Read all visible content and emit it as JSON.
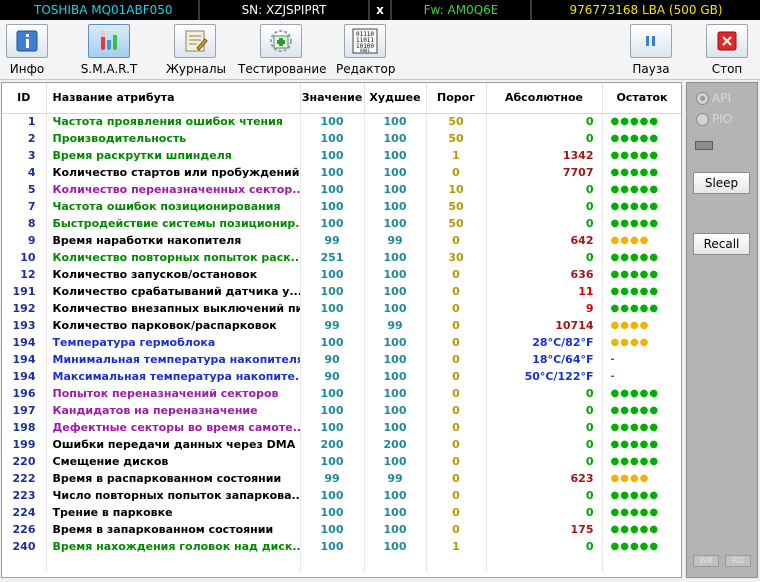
{
  "topbar": {
    "model": "TOSHIBA MQ01ABF050",
    "sn": "SN: XZJSPIPRT",
    "close": "x",
    "fw": "Fw: AM0Q6E",
    "lba": "976773168 LBA (500 GB)"
  },
  "toolbar": {
    "info": "Инфо",
    "smart": "S.M.A.R.T",
    "logs": "Журналы",
    "test": "Тестирование",
    "editor": "Редактор",
    "pause": "Пауза",
    "stop": "Стоп"
  },
  "columns": {
    "id": "ID",
    "name": "Название атрибута",
    "value": "Значение",
    "worst": "Худшее",
    "threshold": "Порог",
    "raw": "Абсолютное",
    "remaining": "Остаток"
  },
  "rows": [
    {
      "id": "1",
      "name": "Частота проявления ошибок чтения",
      "value": "100",
      "worst": "100",
      "threshold": "50",
      "raw": "0",
      "remaining": "●●●●●"
    },
    {
      "id": "2",
      "name": "Производительность",
      "value": "100",
      "worst": "100",
      "threshold": "50",
      "raw": "0",
      "remaining": "●●●●●"
    },
    {
      "id": "3",
      "name": "Время раскрутки шпинделя",
      "value": "100",
      "worst": "100",
      "threshold": "1",
      "raw": "1342",
      "remaining": "●●●●●"
    },
    {
      "id": "4",
      "name": "Количество стартов или пробуждений",
      "value": "100",
      "worst": "100",
      "threshold": "0",
      "raw": "7707",
      "remaining": "●●●●●"
    },
    {
      "id": "5",
      "name": "Количество переназначенных сектор...",
      "value": "100",
      "worst": "100",
      "threshold": "10",
      "raw": "0",
      "remaining": "●●●●●"
    },
    {
      "id": "7",
      "name": "Частота ошибок позиционирования",
      "value": "100",
      "worst": "100",
      "threshold": "50",
      "raw": "0",
      "remaining": "●●●●●"
    },
    {
      "id": "8",
      "name": "Быстродействие системы позиционир...",
      "value": "100",
      "worst": "100",
      "threshold": "50",
      "raw": "0",
      "remaining": "●●●●●"
    },
    {
      "id": "9",
      "name": "Время наработки накопителя",
      "value": "99",
      "worst": "99",
      "threshold": "0",
      "raw": "642",
      "remaining": "●●●●"
    },
    {
      "id": "10",
      "name": "Количество повторных попыток раск...",
      "value": "251",
      "worst": "100",
      "threshold": "30",
      "raw": "0",
      "remaining": "●●●●●"
    },
    {
      "id": "12",
      "name": "Количество запусков/остановок",
      "value": "100",
      "worst": "100",
      "threshold": "0",
      "raw": "636",
      "remaining": "●●●●●"
    },
    {
      "id": "191",
      "name": "Количество срабатываний датчика у...",
      "value": "100",
      "worst": "100",
      "threshold": "0",
      "raw": "11",
      "remaining": "●●●●●"
    },
    {
      "id": "192",
      "name": "Количество внезапных выключений пит...",
      "value": "100",
      "worst": "100",
      "threshold": "0",
      "raw": "9",
      "remaining": "●●●●●"
    },
    {
      "id": "193",
      "name": "Количество парковок/распарковок",
      "value": "99",
      "worst": "99",
      "threshold": "0",
      "raw": "10714",
      "remaining": "●●●●"
    },
    {
      "id": "194",
      "name": "Температура гермоблока",
      "value": "100",
      "worst": "100",
      "threshold": "0",
      "raw": "28°C/82°F",
      "remaining": "●●●●"
    },
    {
      "id": "194",
      "name": "Минимальная температура накопителя",
      "value": "90",
      "worst": "100",
      "threshold": "0",
      "raw": "18°C/64°F",
      "remaining": "-"
    },
    {
      "id": "194",
      "name": "Максимальная температура накопите...",
      "value": "90",
      "worst": "100",
      "threshold": "0",
      "raw": "50°C/122°F",
      "remaining": "-"
    },
    {
      "id": "196",
      "name": "Попыток переназначений секторов",
      "value": "100",
      "worst": "100",
      "threshold": "0",
      "raw": "0",
      "remaining": "●●●●●"
    },
    {
      "id": "197",
      "name": "Кандидатов на переназначение",
      "value": "100",
      "worst": "100",
      "threshold": "0",
      "raw": "0",
      "remaining": "●●●●●"
    },
    {
      "id": "198",
      "name": "Дефектные секторы во время самоте...",
      "value": "100",
      "worst": "100",
      "threshold": "0",
      "raw": "0",
      "remaining": "●●●●●"
    },
    {
      "id": "199",
      "name": "Ошибки передачи данных через DMA",
      "value": "200",
      "worst": "200",
      "threshold": "0",
      "raw": "0",
      "remaining": "●●●●●"
    },
    {
      "id": "220",
      "name": "Смещение дисков",
      "value": "100",
      "worst": "100",
      "threshold": "0",
      "raw": "0",
      "remaining": "●●●●●"
    },
    {
      "id": "222",
      "name": "Время в распаркованном состоянии",
      "value": "99",
      "worst": "99",
      "threshold": "0",
      "raw": "623",
      "remaining": "●●●●"
    },
    {
      "id": "223",
      "name": "Число повторных попыток запарковa...",
      "value": "100",
      "worst": "100",
      "threshold": "0",
      "raw": "0",
      "remaining": "●●●●●"
    },
    {
      "id": "224",
      "name": "Трение в парковке",
      "value": "100",
      "worst": "100",
      "threshold": "0",
      "raw": "0",
      "remaining": "●●●●●"
    },
    {
      "id": "226",
      "name": "Время в запаркованном состоянии",
      "value": "100",
      "worst": "100",
      "threshold": "0",
      "raw": "175",
      "remaining": "●●●●●"
    },
    {
      "id": "240",
      "name": "Время нахождения головок над диск...",
      "value": "100",
      "worst": "100",
      "threshold": "1",
      "raw": "0",
      "remaining": "●●●●●"
    }
  ],
  "panel": {
    "api": "API",
    "pio": "PIO",
    "sleep": "Sleep",
    "recall": "Recall",
    "wr": "WR",
    "rd": "RD"
  },
  "colors": {
    "name_green": "#008a00",
    "name_magenta": "#a01aa8",
    "name_blue": "#1a2fd0",
    "raw_red": "#a01818",
    "raw_zero": "#00a000",
    "remaining_green": "#00b000",
    "remaining_yellow": "#f0b400"
  }
}
